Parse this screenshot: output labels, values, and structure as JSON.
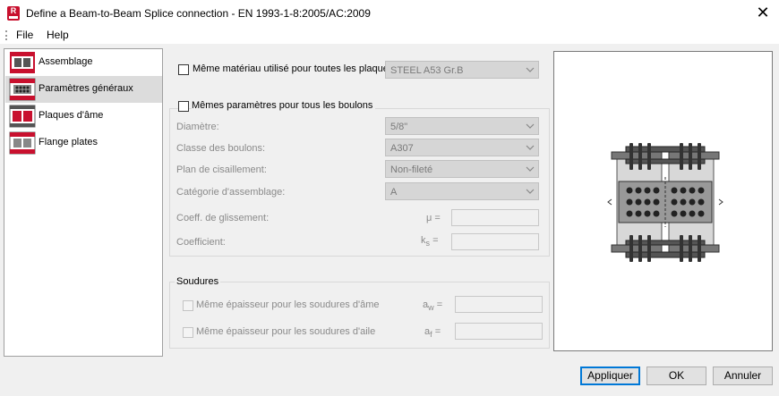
{
  "window": {
    "title": "Define a Beam-to-Beam Splice connection - EN 1993-1-8:2005/AC:2009",
    "app_icon_letter": "R"
  },
  "menu": {
    "file": "File",
    "help": "Help"
  },
  "nav": {
    "items": [
      {
        "label": "Assemblage",
        "selected": false
      },
      {
        "label": "Paramètres généraux",
        "selected": true
      },
      {
        "label": "Plaques d'âme",
        "selected": false
      },
      {
        "label": "Flange plates",
        "selected": false
      }
    ]
  },
  "general": {
    "same_material_label": "Même matériau utilisé pour toutes les plaques",
    "material_value": "STEEL A53 Gr.B",
    "same_bolts_label": "Mêmes paramètres pour tous les boulons",
    "diameter_label": "Diamètre:",
    "diameter_value": "5/8\"",
    "bolt_class_label": "Classe des boulons:",
    "bolt_class_value": "A307",
    "shear_plane_label": "Plan de cisaillement:",
    "shear_plane_value": "Non-fileté",
    "category_label": "Catégorie d'assemblage:",
    "category_value": "A",
    "slip_coeff_label": "Coeff. de glissement:",
    "slip_symbol": "μ =",
    "coeff_label": "Coefficient:",
    "ks_symbol": "k",
    "ks_sub": "s",
    "ks_eq": "="
  },
  "welds": {
    "group_title": "Soudures",
    "web_label": "Même épaisseur pour les soudures d'âme",
    "aw_symbol": "a",
    "aw_sub": "w",
    "aw_eq": "=",
    "flange_label": "Même épaisseur pour les soudures d'aile",
    "af_symbol": "a",
    "af_sub": "f",
    "af_eq": "="
  },
  "buttons": {
    "apply": "Appliquer",
    "ok": "OK",
    "cancel": "Annuler"
  },
  "colors": {
    "brand_red": "#c8102e",
    "default_button_border": "#0078d7"
  }
}
